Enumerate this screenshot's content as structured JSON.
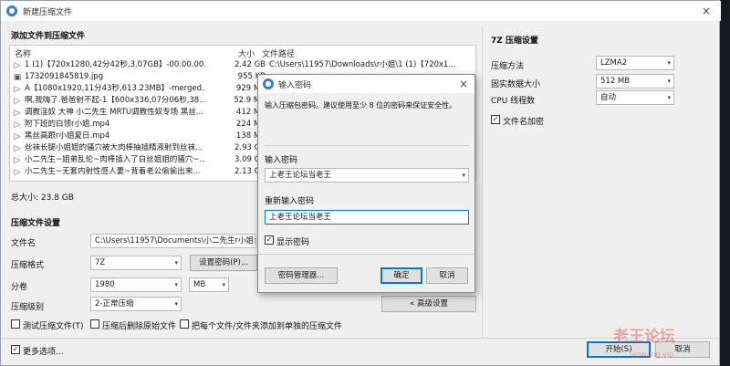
{
  "window": {
    "title": "新建压缩文件",
    "close_label": "×"
  },
  "file_section": {
    "title": "添加文件到压缩文件",
    "col_name": "名称",
    "col_size": "大小",
    "col_path": "文件路径",
    "rows": [
      {
        "icon": "video-file-icon",
        "name": "1 (1)【720x1280,42分42秒,3.07GB】-00.00.00....",
        "size": "2.42 GB",
        "path": "C:\\Users\\11957\\Downloads\\r小姐\\1 (1)【720x1..."
      },
      {
        "icon": "image-file-icon",
        "name": "1732091845819.jpg",
        "size": "955 KB",
        "path": ""
      },
      {
        "icon": "video-file-icon",
        "name": "A【1080x1920,11分43秒,613.23MB】-merged...",
        "size": "929 MB",
        "path": ""
      },
      {
        "icon": "video-file-icon",
        "name": "啊,我嗨了.爸爸射不起-1【600x336,07分06秒,38....",
        "size": "52.9 MB",
        "path": ""
      },
      {
        "icon": "video-file-icon",
        "name": "调教淫奴 大神 小二先生 MRTU调教性奴专场 黑丝...",
        "size": "412 MB",
        "path": ""
      },
      {
        "icon": "video-file-icon",
        "name": "附下班的白领r小姐.mp4",
        "size": "224 MB",
        "path": ""
      },
      {
        "icon": "video-file-icon",
        "name": "黑丝高跟r小姐夏日.mp4",
        "size": "138 MB",
        "path": ""
      },
      {
        "icon": "video-file-icon",
        "name": "丝袜长腿小姐姐的骚穴被大肉棒抽插精液射到丝袜...",
        "size": "2.93 GB",
        "path": ""
      },
      {
        "icon": "video-file-icon",
        "name": "小二先生~姐弟乱伦~肉棒插入了白丝姐姐的骚穴~...",
        "size": "3.09 GB",
        "path": ""
      },
      {
        "icon": "video-file-icon",
        "name": "小二先生~无套内射性感人妻~背着老公偷偷出来...",
        "size": "2.13 GB",
        "path": ""
      }
    ],
    "total": "总大小: 23.8 GB"
  },
  "settings": {
    "title": "压缩文件设置",
    "filename_label": "文件名",
    "filename_value": "C:\\Users\\11957\\Documents\\小二先生r小姐合集",
    "format_label": "压缩格式",
    "format_value": "7Z",
    "set_password_button": "设置密码(P)...",
    "split_label": "分卷",
    "split_value": "1980",
    "split_unit": "MB",
    "level_label": "压缩级别",
    "level_value": "2-正常压缩",
    "advanced_button": "« 高级设置",
    "test_archive": "测试压缩文件(T)",
    "delete_after": "压缩后删除原始文件",
    "separate_each": "把每个文件/文件夹添加到单独的压缩文件",
    "more_options": "更多选项..."
  },
  "seven_z": {
    "title": "7Z 压缩设置",
    "method_label": "压缩方法",
    "method_value": "LZMA2",
    "dict_label": "固实数据大小",
    "dict_value": "512 MB",
    "threads_label": "CPU 线程数",
    "threads_value": "自动",
    "encrypt_names": "文件名加密"
  },
  "bottom": {
    "start_button": "开始(S)",
    "cancel_button": "取消"
  },
  "password_dialog": {
    "title": "输入密码",
    "description": "输入压缩包密码。建议使用至少 8 位的密码来保证安全性。",
    "enter_label": "输入密码",
    "enter_value": "上老王论坛当老王",
    "reenter_label": "重新输入密码",
    "reenter_value": "上老王论坛当老王",
    "show_password": "显示密码",
    "manager_button": "密码管理器...",
    "ok_button": "确定",
    "cancel_button": "取消"
  },
  "watermark": {
    "text": "老王论坛",
    "subtext": "laowang.vip"
  },
  "colors": {
    "accent": "#0078d7",
    "watermark": "#e24848"
  }
}
